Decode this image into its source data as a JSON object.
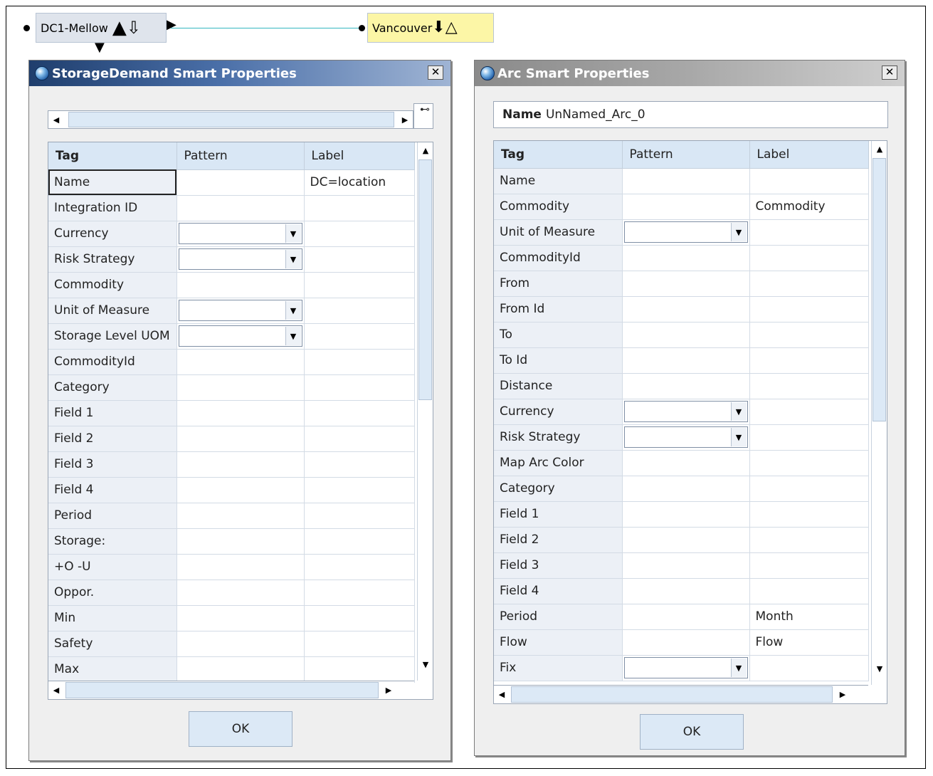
{
  "diagram": {
    "node_from": {
      "label": "DC1-Mellow"
    },
    "node_to": {
      "label": "Vancouver"
    }
  },
  "storage_dialog": {
    "title": "StorageDemand Smart Properties",
    "close_label": "✕",
    "headers": {
      "tag": "Tag",
      "pattern": "Pattern",
      "label": "Label"
    },
    "rows": [
      {
        "tag": "Name",
        "pattern": "",
        "label": "DC=location",
        "dropdown": false
      },
      {
        "tag": "Integration ID",
        "pattern": "",
        "label": "",
        "dropdown": false
      },
      {
        "tag": "Currency",
        "pattern": "",
        "label": "",
        "dropdown": true
      },
      {
        "tag": "Risk Strategy",
        "pattern": "",
        "label": "",
        "dropdown": true
      },
      {
        "tag": "Commodity",
        "pattern": "",
        "label": "",
        "dropdown": false
      },
      {
        "tag": "Unit of Measure",
        "pattern": "",
        "label": "",
        "dropdown": true
      },
      {
        "tag": "Storage Level UOM",
        "pattern": "",
        "label": "",
        "dropdown": true
      },
      {
        "tag": "CommodityId",
        "pattern": "",
        "label": "",
        "dropdown": false
      },
      {
        "tag": "Category",
        "pattern": "",
        "label": "",
        "dropdown": false
      },
      {
        "tag": "Field 1",
        "pattern": "",
        "label": "",
        "dropdown": false
      },
      {
        "tag": "Field 2",
        "pattern": "",
        "label": "",
        "dropdown": false
      },
      {
        "tag": "Field 3",
        "pattern": "",
        "label": "",
        "dropdown": false
      },
      {
        "tag": "Field 4",
        "pattern": "",
        "label": "",
        "dropdown": false
      },
      {
        "tag": "Period",
        "pattern": "",
        "label": "",
        "dropdown": false
      },
      {
        "tag": "Storage:",
        "pattern": "",
        "label": "",
        "dropdown": false
      },
      {
        "tag": "+O -U",
        "pattern": "",
        "label": "",
        "dropdown": false
      },
      {
        "tag": "Oppor.",
        "pattern": "",
        "label": "",
        "dropdown": false
      },
      {
        "tag": "Min",
        "pattern": "",
        "label": "",
        "dropdown": false
      },
      {
        "tag": "Safety",
        "pattern": "",
        "label": "",
        "dropdown": false
      },
      {
        "tag": "Max",
        "pattern": "",
        "label": "",
        "dropdown": false
      }
    ],
    "ok_label": "OK"
  },
  "arc_dialog": {
    "title": "Arc Smart Properties",
    "close_label": "✕",
    "name_label": "Name",
    "name_value": "UnNamed_Arc_0",
    "headers": {
      "tag": "Tag",
      "pattern": "Pattern",
      "label": "Label"
    },
    "rows": [
      {
        "tag": "Name",
        "pattern": "",
        "label": "",
        "dropdown": false
      },
      {
        "tag": "Commodity",
        "pattern": "",
        "label": "Commodity",
        "dropdown": false
      },
      {
        "tag": "Unit of Measure",
        "pattern": "",
        "label": "",
        "dropdown": true
      },
      {
        "tag": "CommodityId",
        "pattern": "",
        "label": "",
        "dropdown": false
      },
      {
        "tag": "From",
        "pattern": "",
        "label": "",
        "dropdown": false
      },
      {
        "tag": "From Id",
        "pattern": "",
        "label": "",
        "dropdown": false
      },
      {
        "tag": "To",
        "pattern": "",
        "label": "",
        "dropdown": false
      },
      {
        "tag": "To Id",
        "pattern": "",
        "label": "",
        "dropdown": false
      },
      {
        "tag": "Distance",
        "pattern": "",
        "label": "",
        "dropdown": false
      },
      {
        "tag": "Currency",
        "pattern": "",
        "label": "",
        "dropdown": true
      },
      {
        "tag": "Risk Strategy",
        "pattern": "",
        "label": "",
        "dropdown": true
      },
      {
        "tag": "Map Arc Color",
        "pattern": "",
        "label": "",
        "dropdown": false
      },
      {
        "tag": "Category",
        "pattern": "",
        "label": "",
        "dropdown": false
      },
      {
        "tag": "Field 1",
        "pattern": "",
        "label": "",
        "dropdown": false
      },
      {
        "tag": "Field 2",
        "pattern": "",
        "label": "",
        "dropdown": false
      },
      {
        "tag": "Field 3",
        "pattern": "",
        "label": "",
        "dropdown": false
      },
      {
        "tag": "Field 4",
        "pattern": "",
        "label": "",
        "dropdown": false
      },
      {
        "tag": "Period",
        "pattern": "",
        "label": "Month",
        "dropdown": false
      },
      {
        "tag": "Flow",
        "pattern": "",
        "label": "Flow",
        "dropdown": false
      },
      {
        "tag": "Fix",
        "pattern": "",
        "label": "",
        "dropdown": true
      }
    ],
    "ok_label": "OK"
  },
  "colors": {
    "active_title": "#1f3e6d",
    "inactive_title": "#8a8a8a",
    "header_bg": "#d9e7f5",
    "connector": "#35b8c0",
    "node_to_bg": "#fcf6a6"
  }
}
